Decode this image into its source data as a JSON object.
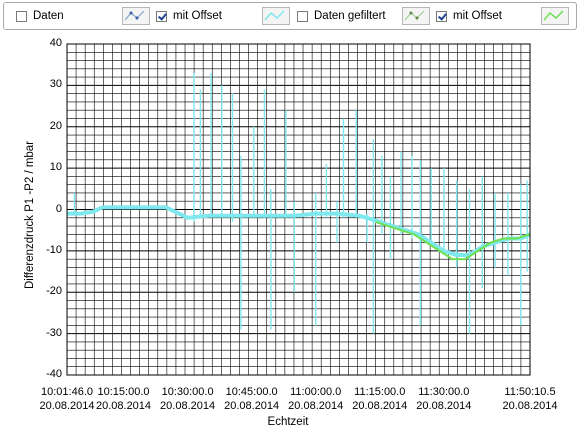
{
  "legend": {
    "items": [
      {
        "label": "Daten",
        "checked": false
      },
      {
        "label": "mit Offset",
        "checked": true
      },
      {
        "label": "Daten gefiltert",
        "checked": false
      },
      {
        "label": "mit Offset",
        "checked": true
      }
    ]
  },
  "chart_data": {
    "type": "line",
    "xlabel": "Echtzeit",
    "ylabel": "Differenzdruck P1 -P2 / mbar",
    "ylim": [
      -40,
      40
    ],
    "grid": true,
    "y_ticks": [
      "40",
      "30",
      "20",
      "10",
      "0",
      "-10",
      "-20",
      "-30",
      "-40"
    ],
    "x_ticks": [
      {
        "time": "10:01:46.0",
        "date": "20.08.2014"
      },
      {
        "time": "10:15:00.0",
        "date": "20.08.2014"
      },
      {
        "time": "10:30:00.0",
        "date": "20.08.2014"
      },
      {
        "time": "10:45:00.0",
        "date": "20.08.2014"
      },
      {
        "time": "11:00:00.0",
        "date": "20.08.2014"
      },
      {
        "time": "11:15:00.0",
        "date": "20.08.2014"
      },
      {
        "time": "11:30:00.0",
        "date": "20.08.2014"
      },
      {
        "time": "11:50:10.5",
        "date": "20.08.2014"
      }
    ],
    "series": [
      {
        "color": "#7fe8ee",
        "x": [
          "10:01:46",
          "10:05:00",
          "10:08:00",
          "10:10:00",
          "10:13:00",
          "10:15:00",
          "10:20:00",
          "10:25:00",
          "10:30:00",
          "10:35:00",
          "10:40:00",
          "10:45:00",
          "10:50:00",
          "10:55:00",
          "11:00:00",
          "11:05:00",
          "11:10:00",
          "11:12:00",
          "11:15:00",
          "11:18:00",
          "11:21:00",
          "11:24:00",
          "11:27:00",
          "11:30:00",
          "11:33:00",
          "11:36:00",
          "11:39:00",
          "11:42:00",
          "11:45:00",
          "11:48:00",
          "11:50:10"
        ],
        "values": [
          -1,
          -1,
          -0.5,
          0.5,
          0.5,
          0.5,
          0.5,
          0.5,
          -2,
          -1.5,
          -1.5,
          -1.5,
          -1.5,
          -1.5,
          -1,
          -1,
          -1.5,
          -2,
          -3,
          -4,
          -5,
          -6,
          -8,
          -10,
          -11,
          -11,
          -9,
          -8,
          -7,
          -7,
          -6
        ]
      },
      {
        "color": "#6ee050",
        "x": [
          "11:14:00",
          "11:17:00",
          "11:20:00",
          "11:23:00",
          "11:26:00",
          "11:29:00",
          "11:32:00",
          "11:35:00",
          "11:38:00",
          "11:41:00",
          "11:44:00",
          "11:47:00",
          "11:50:10"
        ],
        "values": [
          -3,
          -4,
          -5,
          -6,
          -8,
          -10,
          -12,
          -12,
          -10,
          -8,
          -7,
          -7,
          -6
        ]
      }
    ],
    "spikes": [
      {
        "x": "10:03:30",
        "high": 4,
        "low": -1
      },
      {
        "x": "10:31:30",
        "high": 33,
        "low": -3
      },
      {
        "x": "10:33:00",
        "high": 29,
        "low": -2
      },
      {
        "x": "10:35:30",
        "high": 33,
        "low": -2
      },
      {
        "x": "10:38:00",
        "high": 30,
        "low": -2
      },
      {
        "x": "10:40:30",
        "high": 28,
        "low": -3
      },
      {
        "x": "10:42:30",
        "high": 13,
        "low": -29
      },
      {
        "x": "10:45:30",
        "high": 20,
        "low": -2
      },
      {
        "x": "10:48:00",
        "high": 29,
        "low": -2
      },
      {
        "x": "10:49:30",
        "high": 5,
        "low": -29
      },
      {
        "x": "10:53:00",
        "high": 24,
        "low": -2
      },
      {
        "x": "10:55:00",
        "high": 2,
        "low": -20
      },
      {
        "x": "11:00:00",
        "high": 4,
        "low": -28
      },
      {
        "x": "11:02:30",
        "high": 11,
        "low": -2
      },
      {
        "x": "11:05:00",
        "high": 2,
        "low": -8
      },
      {
        "x": "11:06:30",
        "high": 22,
        "low": -2
      },
      {
        "x": "11:09:30",
        "high": 24,
        "low": -2
      },
      {
        "x": "11:12:00",
        "high": -1,
        "low": -8
      },
      {
        "x": "11:13:30",
        "high": 17,
        "low": -30
      },
      {
        "x": "11:15:30",
        "high": 13,
        "low": -6
      },
      {
        "x": "11:17:30",
        "high": 8,
        "low": -12
      },
      {
        "x": "11:20:00",
        "high": 14,
        "low": -6
      },
      {
        "x": "11:22:30",
        "high": 13,
        "low": -7
      },
      {
        "x": "11:24:30",
        "high": 12,
        "low": -28
      },
      {
        "x": "11:27:00",
        "high": 10,
        "low": -8
      },
      {
        "x": "11:30:00",
        "high": 10,
        "low": -11
      },
      {
        "x": "11:33:00",
        "high": 7,
        "low": -14
      },
      {
        "x": "11:36:00",
        "high": 5,
        "low": -30
      },
      {
        "x": "11:39:00",
        "high": 8,
        "low": -19
      },
      {
        "x": "11:42:00",
        "high": 4,
        "low": -14
      },
      {
        "x": "11:45:00",
        "high": 4,
        "low": -16
      },
      {
        "x": "11:48:00",
        "high": 6,
        "low": -28
      },
      {
        "x": "11:49:30",
        "high": 7,
        "low": -15
      }
    ]
  }
}
